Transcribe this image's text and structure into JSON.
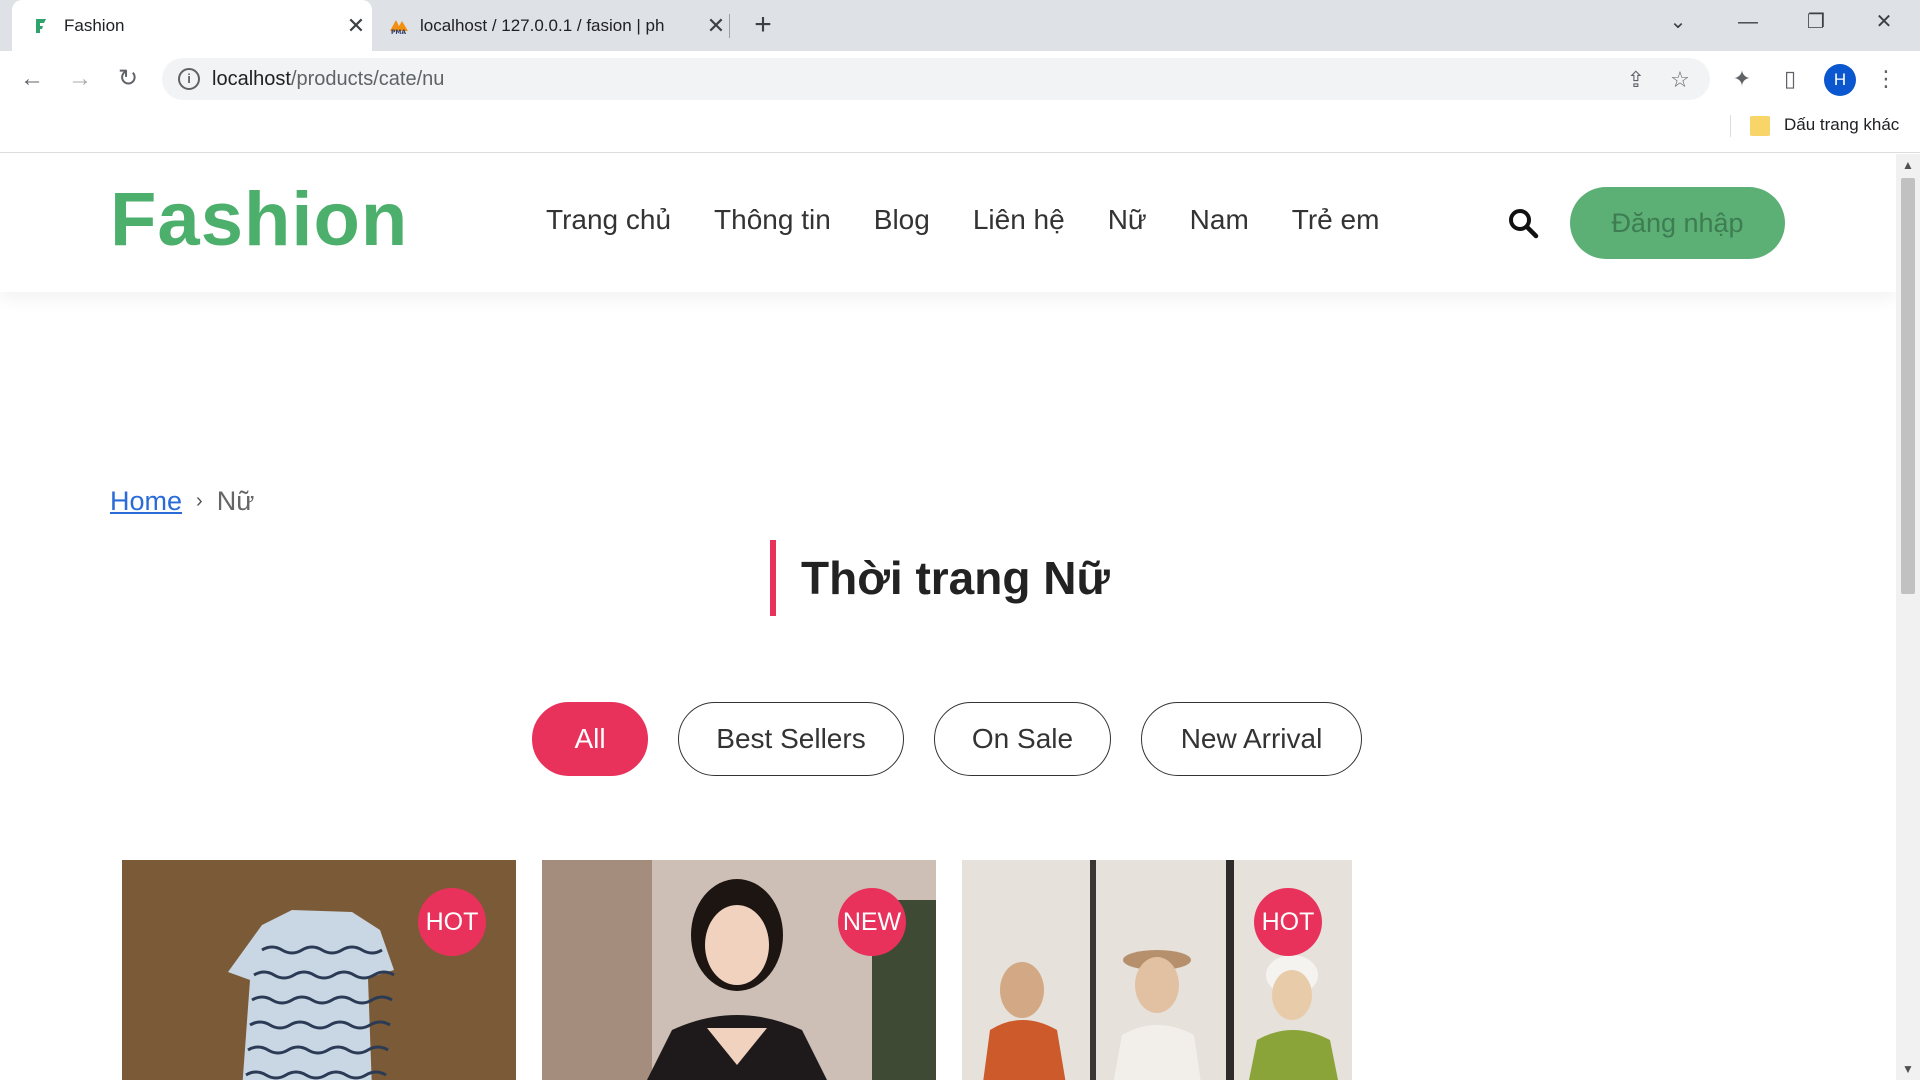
{
  "browser": {
    "tabs": [
      {
        "title": "Fashion",
        "favicon": "fashion-favicon",
        "active": true
      },
      {
        "title": "localhost / 127.0.0.1 / fasion | ph",
        "favicon": "phpmyadmin-favicon",
        "active": false
      }
    ],
    "url_host": "localhost",
    "url_path": "/products/cate/nu",
    "profile_initial": "H",
    "bookmark_folder_label": "Dấu trang khác"
  },
  "site": {
    "logo": "Fashion",
    "nav": [
      "Trang chủ",
      "Thông tin",
      "Blog",
      "Liên hệ",
      "Nữ",
      "Nam",
      "Trẻ em"
    ],
    "login_label": "Đăng nhập",
    "brand_color": "#4caf6c",
    "accent_color": "#e8325c"
  },
  "breadcrumb": {
    "home": "Home",
    "separator": "›",
    "current": "Nữ"
  },
  "section_title": "Thời trang Nữ",
  "filters": [
    {
      "label": "All",
      "active": true
    },
    {
      "label": "Best Sellers",
      "active": false
    },
    {
      "label": "On Sale",
      "active": false
    },
    {
      "label": "New Arrival",
      "active": false
    }
  ],
  "products": [
    {
      "badge": "HOT",
      "image": "striped-shirt-photo"
    },
    {
      "badge": "NEW",
      "image": "woman-cafe-photo"
    },
    {
      "badge": "HOT",
      "image": "women-mirror-selfie-photo"
    }
  ]
}
